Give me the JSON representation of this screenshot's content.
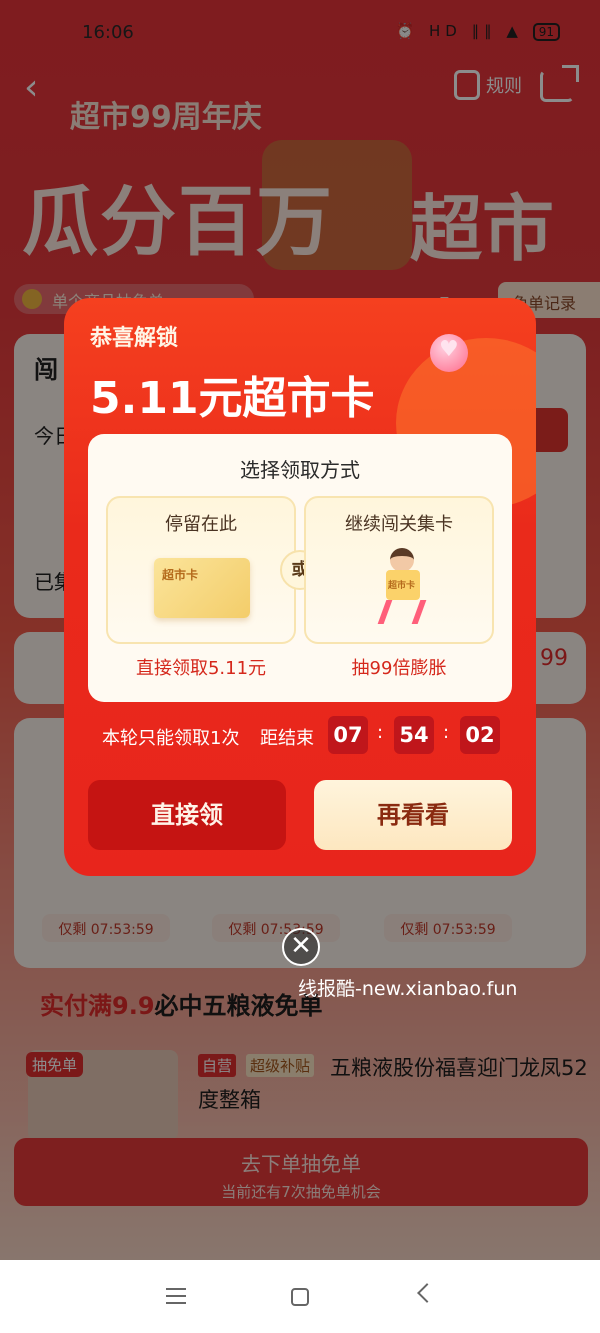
{
  "status_bar": {
    "time": "16:06",
    "icons": "⏰ HD ∥∥ ▲",
    "battery": "91"
  },
  "header": {
    "rules_label": "规则"
  },
  "banner": {
    "subtitle": "超市99周年庆",
    "title_left": "瓜分百万",
    "title_right": "超市卡"
  },
  "background": {
    "notice": "单个商品抽免单",
    "record_label": "免单记录",
    "card1_initial": "闯",
    "card1_line2": "今日",
    "card1_line3": "已集",
    "card2_value": "99",
    "chips": [
      "仅剩 07:53:59",
      "仅剩 07:53:59",
      "仅剩 07:53:59"
    ],
    "section_title_red": "实付满9.9",
    "section_title_rest": "必中五粮液免单",
    "product_tag": "抽免单",
    "product_badge_self": "自营",
    "product_badge_subsidy": "超级补贴",
    "product_title": "五粮液股份福喜迎门龙凤52度整箱",
    "order_button_line1": "去下单抽免单",
    "order_button_line2": "当前还有7次抽免单机会"
  },
  "popup": {
    "kicker": "恭喜解锁",
    "title": "5.11元超市卡",
    "choose_title": "选择领取方式",
    "option_left_label": "停留在此",
    "option_left_card": "超市卡",
    "option_left_foot": "直接领取5.11元",
    "or_label": "或",
    "option_right_label": "继续闯关集卡",
    "option_right_card": "超市卡",
    "option_right_foot": "抽99倍膨胀",
    "limit_note": "本轮只能领取1次",
    "ends_label": "距结束",
    "countdown": {
      "hours": "07",
      "minutes": "54",
      "seconds": "02"
    },
    "claim_button": "直接领",
    "more_button": "再看看"
  },
  "close_icon_glyph": "✕",
  "watermark": "线报酷-new.xianbao.fun"
}
